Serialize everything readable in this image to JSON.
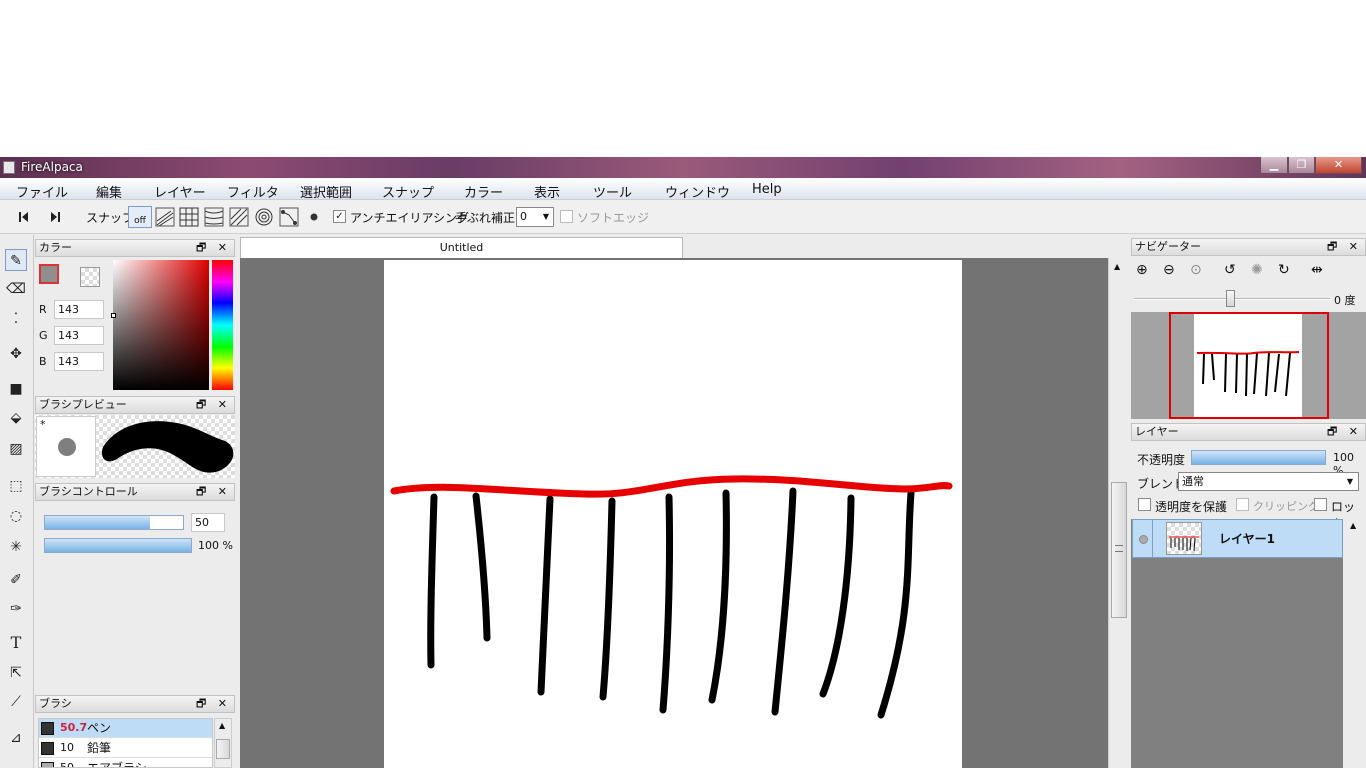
{
  "window": {
    "title": "FireAlpaca"
  },
  "menu": [
    "ファイル",
    "編集",
    "レイヤー",
    "フィルタ",
    "選択範囲",
    "スナップ",
    "カラー",
    "表示",
    "ツール",
    "ウィンドウ",
    "Help"
  ],
  "toolbar": {
    "snap_label": "スナップ",
    "snap_off": "off",
    "antialias_label": "アンチエイリアシング",
    "antialias_checked": "✓",
    "stabilizer_label": "手ぶれ補正",
    "stabilizer_value": "0",
    "soft_edge_label": "ソフトエッジ"
  },
  "color_panel": {
    "title": "カラー",
    "r_label": "R",
    "g_label": "G",
    "b_label": "B",
    "r": "143",
    "g": "143",
    "b": "143",
    "current_color": "#8f8f8f"
  },
  "brush_preview": {
    "title": "ブラシプレビュー",
    "marker": "*"
  },
  "brush_control": {
    "title": "ブラシコントロール",
    "size_value": "50",
    "size_fraction": 0.76,
    "opacity_value": "100 %",
    "opacity_fraction": 1.0
  },
  "brush_panel": {
    "title": "ブラシ",
    "items": [
      {
        "size": "50.7",
        "name": "ペン",
        "selected": true
      },
      {
        "size": "10",
        "name": "鉛筆",
        "selected": false
      },
      {
        "size": "50",
        "name": "エアブラシ",
        "selected": false
      }
    ]
  },
  "document": {
    "tab_title": "Untitled"
  },
  "navigator": {
    "title": "ナビゲーター",
    "rotation": "0 度"
  },
  "layers_panel": {
    "title": "レイヤー",
    "opacity_label": "不透明度",
    "opacity_value": "100 %",
    "blend_label": "ブレンド",
    "blend_value": "通常",
    "protect_alpha_label": "透明度を保護",
    "clipping_label": "クリッピング",
    "lock_label": "ロック",
    "layers": [
      {
        "name": "レイヤー1"
      }
    ]
  },
  "panel_controls": "🗗 ✕",
  "colors": {
    "accent_red": "#e60000",
    "selection_blue": "#bfdcf6"
  }
}
